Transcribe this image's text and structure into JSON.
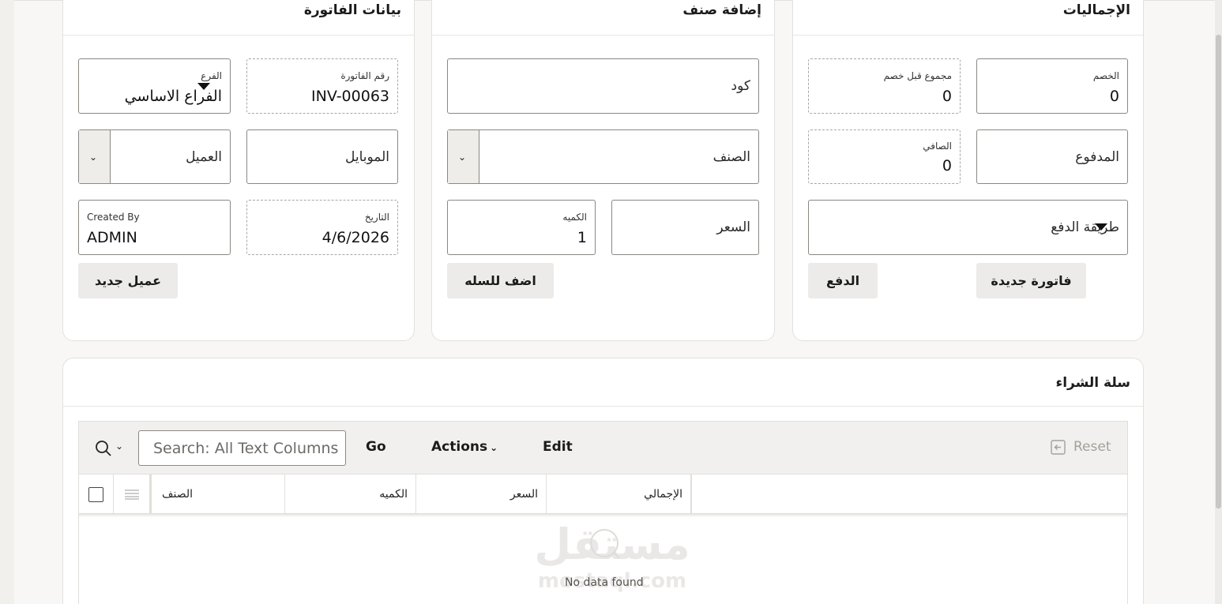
{
  "invoice_card": {
    "title": "بيانات الفاتورة",
    "branch_label": "الفرع",
    "branch_value": "الفراع الاساسي",
    "invoice_no_label": "رقم الفاتورة",
    "invoice_no_value": "INV-00063",
    "customer_placeholder": "العميل",
    "mobile_placeholder": "الموبايل",
    "created_by_label": "Created By",
    "created_by_value": "ADMIN",
    "date_label": "التاريخ",
    "date_value": "4/6/2026",
    "new_customer_button": "عميل جديد"
  },
  "add_item_card": {
    "title": "إضافة صنف",
    "code_placeholder": "كود",
    "item_placeholder": "الصنف",
    "qty_label": "الكميه",
    "qty_value": "1",
    "price_placeholder": "السعر",
    "add_to_cart_button": "اضف للسله"
  },
  "totals_card": {
    "title": "الإجماليات",
    "subtotal_label": "مجموع قبل خصم",
    "subtotal_value": "0",
    "discount_label": "الخصم",
    "discount_value": "0",
    "net_label": "الصافي",
    "net_value": "0",
    "paid_placeholder": "المدفوع",
    "payment_method_placeholder": "طريقة الدفع",
    "pay_button": "الدفع",
    "new_invoice_button": "فاتورة جديدة"
  },
  "cart": {
    "title": "سلة الشراء",
    "search_placeholder": "Search: All Text Columns",
    "go": "Go",
    "actions": "Actions",
    "edit": "Edit",
    "reset": "Reset",
    "columns": [
      "الصنف",
      "الكميه",
      "السعر",
      "الإجمالي"
    ],
    "no_data": "No data found"
  },
  "watermark": {
    "text": "مستقل",
    "domain": "mostaql.com"
  }
}
